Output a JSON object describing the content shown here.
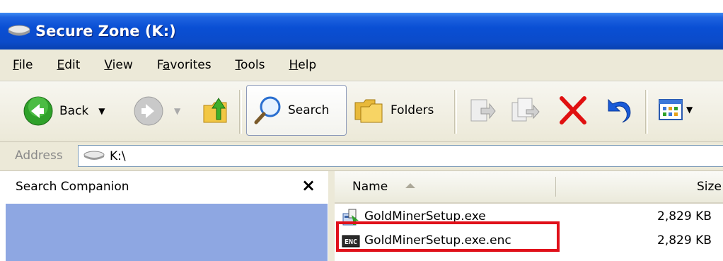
{
  "window": {
    "title": "Secure Zone (K:)",
    "title_icon": "drive-icon"
  },
  "menubar": {
    "items": [
      {
        "label": "File",
        "underline": "F"
      },
      {
        "label": "Edit",
        "underline": "E"
      },
      {
        "label": "View",
        "underline": "V"
      },
      {
        "label": "Favorites",
        "underline": "a"
      },
      {
        "label": "Tools",
        "underline": "T"
      },
      {
        "label": "Help",
        "underline": "H"
      }
    ]
  },
  "toolbar": {
    "back_label": "Back",
    "search_label": "Search",
    "folders_label": "Folders"
  },
  "address": {
    "label": "Address",
    "value": "K:\\"
  },
  "search_pane": {
    "title": "Search Companion",
    "close_glyph": "×"
  },
  "file_list": {
    "columns": [
      "Name",
      "Size"
    ],
    "files": [
      {
        "name": "GoldMinerSetup.exe",
        "size": "2,829 KB",
        "icon": "installer-icon"
      },
      {
        "name": "GoldMinerSetup.exe.enc",
        "size": "2,829 KB",
        "icon": "encrypted-file-icon",
        "highlighted": true
      }
    ]
  },
  "colors": {
    "titlebar": "#0b4bc9",
    "chrome": "#ece9d8",
    "pane_body": "#8ea7e2",
    "highlight": "#e0101a",
    "delete_red": "#e01010",
    "undo_blue": "#1a5bd8"
  }
}
